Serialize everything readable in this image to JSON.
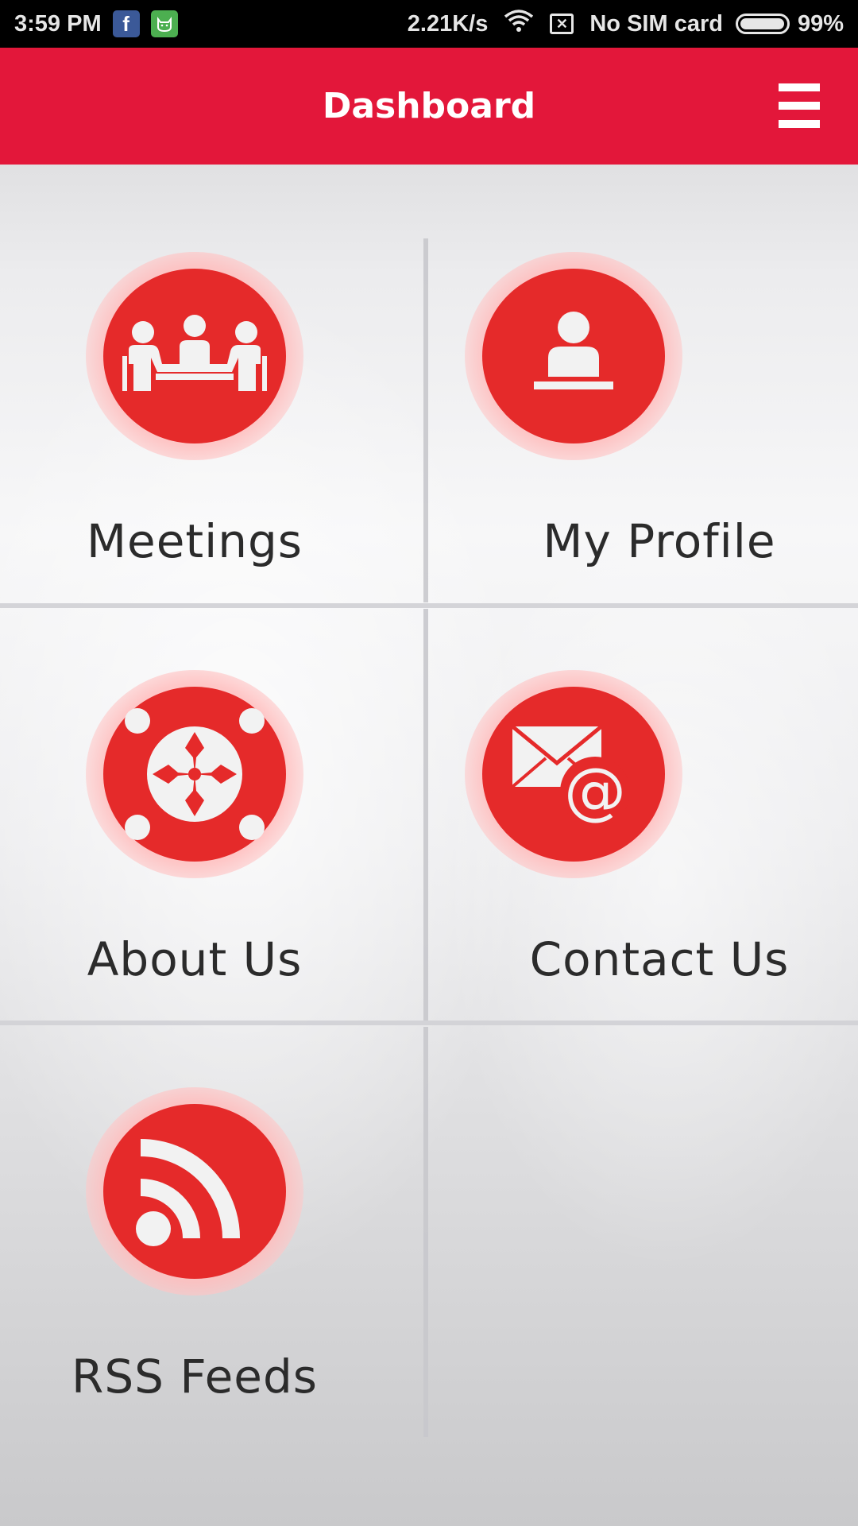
{
  "status_bar": {
    "time": "3:59 PM",
    "app_icons": [
      "facebook-icon",
      "cat-icon"
    ],
    "speed": "2.21K/s",
    "sim": "No SIM card",
    "battery": "99%",
    "battery_level": 0.99
  },
  "header": {
    "title": "Dashboard",
    "menu_icon": "hamburger-menu-icon"
  },
  "tiles": [
    {
      "label": "Meetings",
      "icon": "meetings-icon"
    },
    {
      "label": "My Profile",
      "icon": "profile-icon"
    },
    {
      "label": "About Us",
      "icon": "about-us-icon"
    },
    {
      "label": "Contact Us",
      "icon": "contact-email-icon"
    },
    {
      "label": "RSS Feeds",
      "icon": "rss-icon"
    }
  ],
  "colors": {
    "accent": "#e3173a",
    "icon_red": "#e52a2a"
  }
}
